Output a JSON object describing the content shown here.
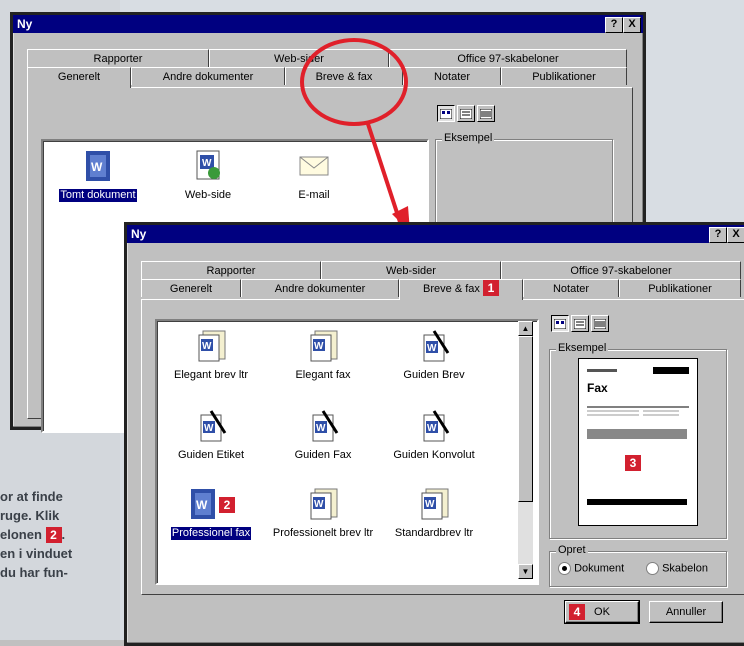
{
  "colors": {
    "titlebar": "#000080",
    "callout": "#e0202a",
    "badge": "#d2202f"
  },
  "side_text": [
    "or at finde",
    "ruge. Klik",
    "elonen ",
    "en i vinduet",
    "du har fun-"
  ],
  "side_badge": "2",
  "outer": {
    "title": "Ny",
    "buttons": {
      "help": "?",
      "close": "X"
    },
    "tabs_back": [
      "Rapporter",
      "Web-sider",
      "Office 97-skabeloner"
    ],
    "tabs_front": [
      "Generelt",
      "Andre dokumenter",
      "Breve & fax",
      "Notater",
      "Publikationer"
    ],
    "items": [
      {
        "label": "Tomt dokument",
        "icon": "word-doc-icon",
        "selected": true
      },
      {
        "label": "Web-side",
        "icon": "web-page-icon"
      },
      {
        "label": "E-mail",
        "icon": "envelope-icon"
      }
    ],
    "preview_label": "Eksempel"
  },
  "inner": {
    "title": "Ny",
    "buttons": {
      "help": "?",
      "close": "X"
    },
    "tabs_back": [
      "Rapporter",
      "Web-sider",
      "Office 97-skabeloner"
    ],
    "tabs_front": [
      "Generelt",
      "Andre dokumenter",
      "Breve & fax",
      "Notater",
      "Publikationer"
    ],
    "active_tab_badge": "1",
    "items": [
      {
        "label": "Elegant brev ltr",
        "icon": "word-template-icon"
      },
      {
        "label": "Elegant fax",
        "icon": "word-template-icon"
      },
      {
        "label": "Guiden Brev",
        "icon": "wizard-icon"
      },
      {
        "label": "Guiden Etiket",
        "icon": "wizard-icon"
      },
      {
        "label": "Guiden Fax",
        "icon": "wizard-icon"
      },
      {
        "label": "Guiden Konvolut",
        "icon": "wizard-icon"
      },
      {
        "label": "Professionel fax",
        "icon": "word-doc-icon",
        "selected": true
      },
      {
        "label": "Professionelt brev ltr",
        "icon": "word-template-icon"
      },
      {
        "label": "Standardbrev ltr",
        "icon": "word-template-icon"
      }
    ],
    "item_badge": "2",
    "preview_label": "Eksempel",
    "preview_heading": "Fax",
    "preview_badge": "3",
    "create_group": "Opret",
    "radio_document": "Dokument",
    "radio_template": "Skabelon",
    "ok_badge": "4",
    "ok": "OK",
    "cancel": "Annuller"
  }
}
